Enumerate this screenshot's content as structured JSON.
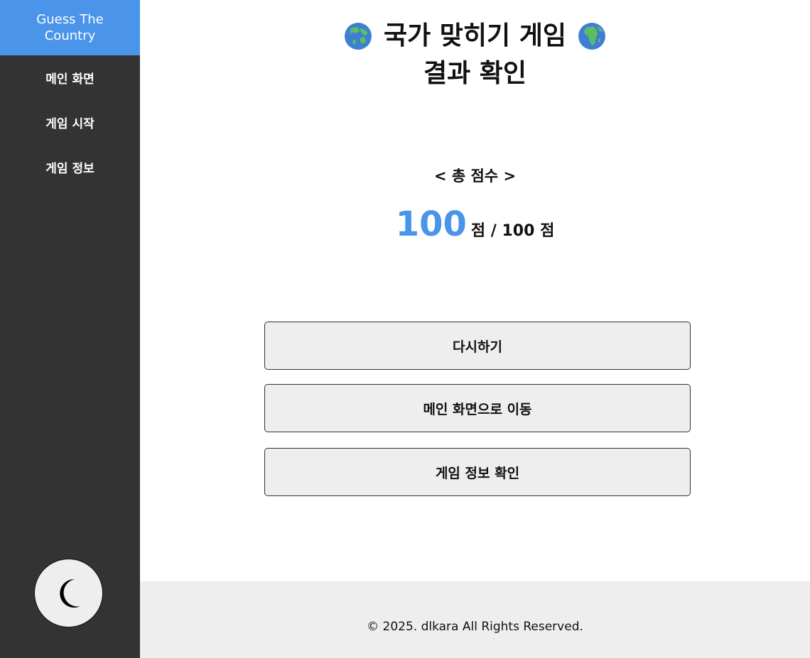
{
  "sidebar": {
    "brand": "Guess The Country",
    "items": [
      {
        "label": "메인 화면"
      },
      {
        "label": "게임 시작"
      },
      {
        "label": "게임 정보"
      }
    ],
    "theme_toggle_icon": "moon-icon"
  },
  "header": {
    "title_line1": "국가 맞히기 게임",
    "title_line2": "결과 확인",
    "left_icon": "globe-asia-icon",
    "right_icon": "globe-africa-icon"
  },
  "score": {
    "label": "< 총 점수 >",
    "value": "100",
    "suffix": "점 / 100 점"
  },
  "buttons": {
    "retry": "다시하기",
    "go_main": "메인 화면으로 이동",
    "game_info": "게임 정보 확인"
  },
  "footer": {
    "copyright": "© 2025. dlkara All Rights Reserved."
  },
  "colors": {
    "accent": "#4a94ea",
    "sidebar_bg": "#333333",
    "button_bg": "#eeeeee",
    "footer_bg": "#eeeeee"
  }
}
